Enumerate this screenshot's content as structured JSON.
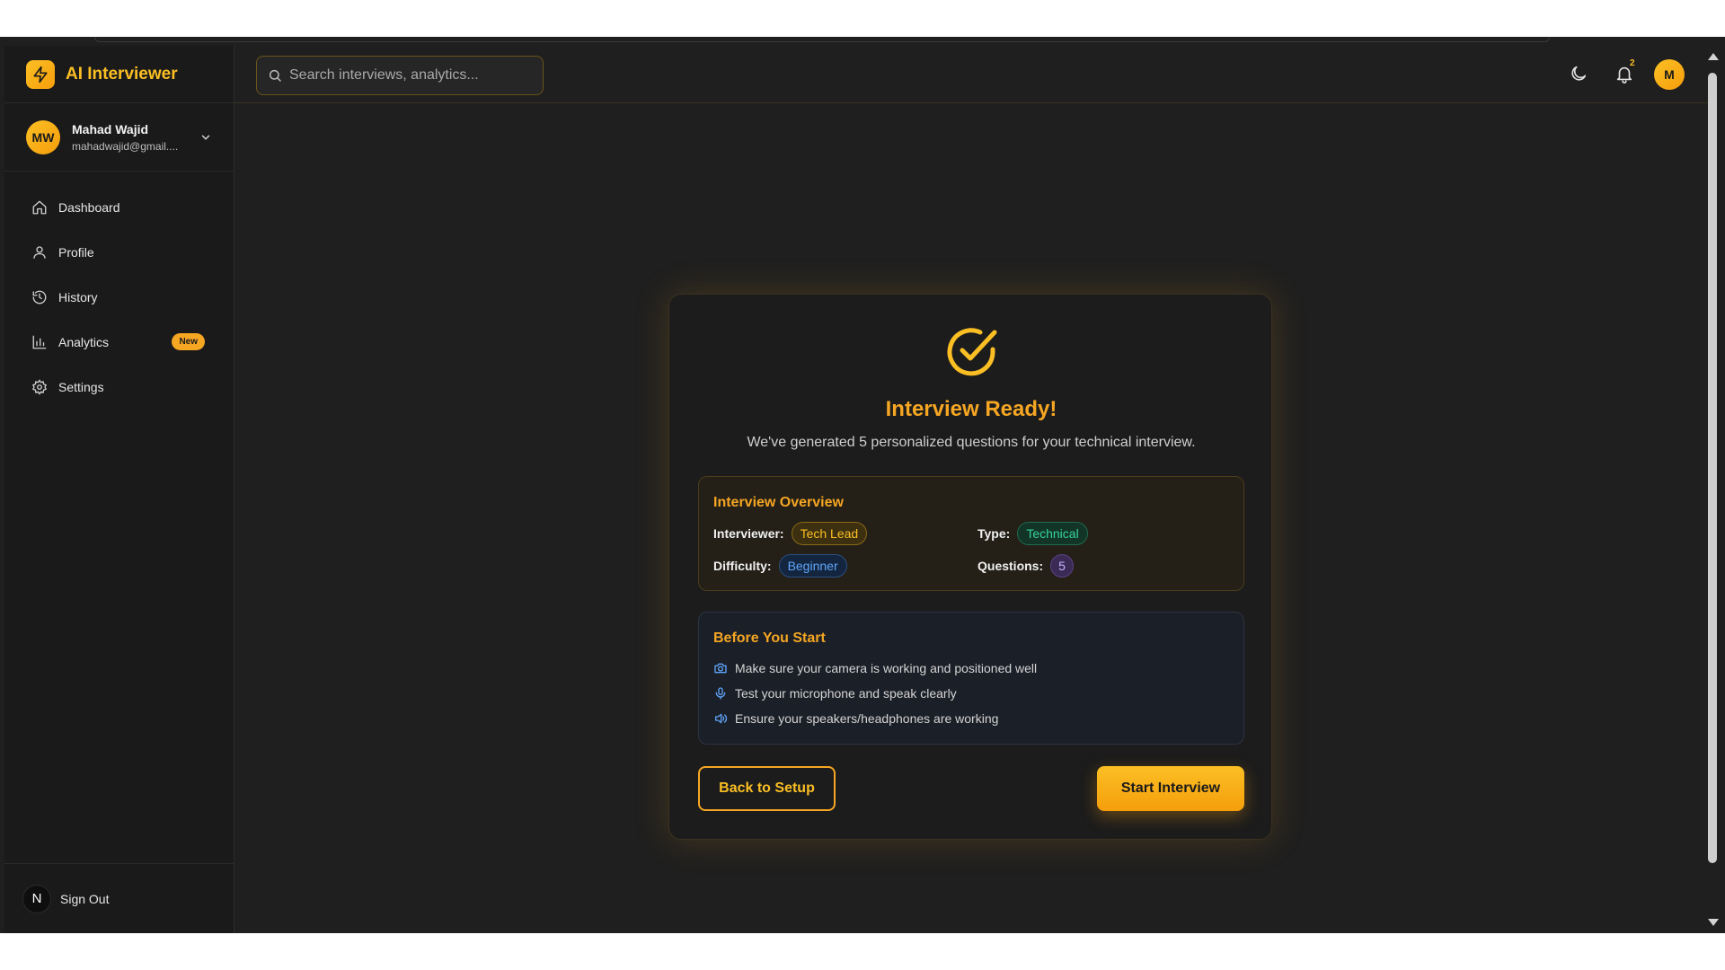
{
  "brand": {
    "title": "AI Interviewer"
  },
  "user": {
    "initials": "MW",
    "name": "Mahad Wajid",
    "email": "mahadwajid@gmail...."
  },
  "sidebar": {
    "items": [
      {
        "label": "Dashboard",
        "icon": "home-icon"
      },
      {
        "label": "Profile",
        "icon": "user-icon"
      },
      {
        "label": "History",
        "icon": "history-icon"
      },
      {
        "label": "Analytics",
        "icon": "bar-chart-icon",
        "badge": "New"
      },
      {
        "label": "Settings",
        "icon": "gear-icon"
      }
    ],
    "footer": {
      "logo": "N",
      "label": "Sign Out"
    }
  },
  "header": {
    "search_placeholder": "Search interviews, analytics...",
    "notification_count": "2",
    "avatar_initial": "M"
  },
  "card": {
    "title": "Interview Ready!",
    "subtitle": "We've generated 5 personalized questions for your technical interview.",
    "overview": {
      "title": "Interview Overview",
      "interviewer_label": "Interviewer:",
      "interviewer_value": "Tech Lead",
      "type_label": "Type:",
      "type_value": "Technical",
      "difficulty_label": "Difficulty:",
      "difficulty_value": "Beginner",
      "questions_label": "Questions:",
      "questions_value": "5"
    },
    "before": {
      "title": "Before You Start",
      "tips": [
        "Make sure your camera is working and positioned well",
        "Test your microphone and speak clearly",
        "Ensure your speakers/headphones are working"
      ]
    },
    "back_label": "Back to Setup",
    "start_label": "Start Interview"
  },
  "colors": {
    "accent": "#f5a623",
    "background": "#1f1f1f",
    "sidebar": "#1a1a1a"
  }
}
